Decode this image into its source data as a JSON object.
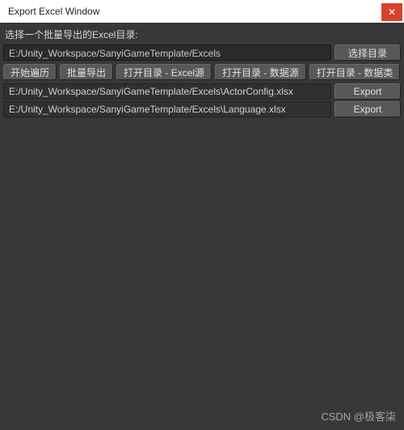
{
  "window": {
    "title": "Export Excel Window",
    "close_icon": "✕"
  },
  "label": {
    "choose_dir": "选择一个批量导出的Excel目录:"
  },
  "path_input": {
    "value": "E:/Unity_Workspace/SanyiGameTemplate/Excels"
  },
  "buttons": {
    "select_dir": "选择目录",
    "start_traverse": "开始遍历",
    "batch_export": "批量导出",
    "open_excel_src": "打开目录 - Excel源",
    "open_data_src": "打开目录 - 数据源",
    "open_data_class": "打开目录 - 数据类",
    "export": "Export"
  },
  "files": [
    {
      "path": "E:/Unity_Workspace/SanyiGameTemplate/Excels\\ActorConfig.xlsx"
    },
    {
      "path": "E:/Unity_Workspace/SanyiGameTemplate/Excels\\Language.xlsx"
    }
  ],
  "watermark": "CSDN @极客柒"
}
